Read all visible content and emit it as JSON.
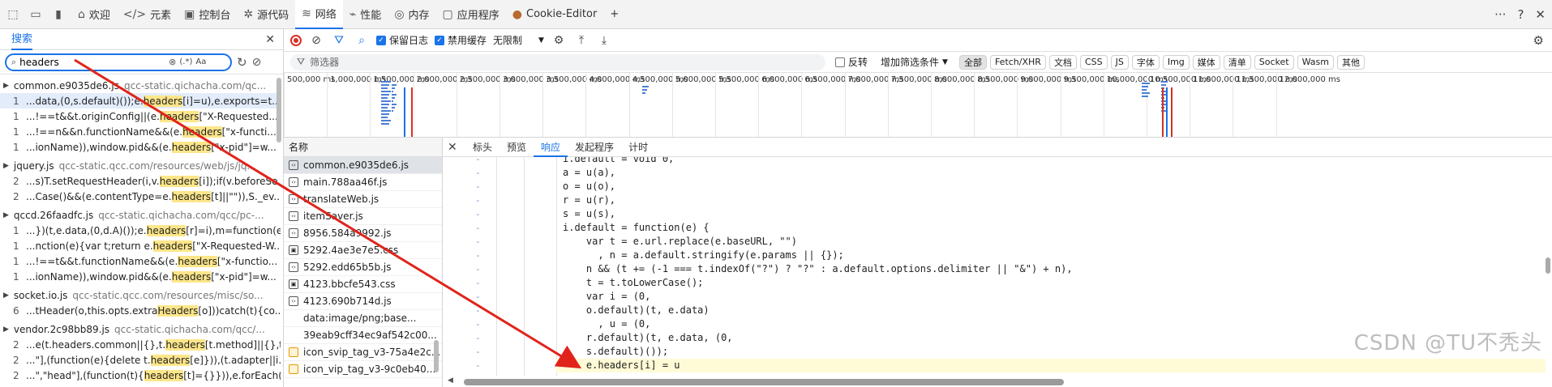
{
  "topbar": {
    "tabs": [
      {
        "label": "欢迎",
        "icon": "home-icon"
      },
      {
        "label": "元素",
        "icon": "code-icon"
      },
      {
        "label": "控制台",
        "icon": "console-icon"
      },
      {
        "label": "源代码",
        "icon": "bug-icon"
      },
      {
        "label": "网络",
        "icon": "wifi-icon"
      },
      {
        "label": "性能",
        "icon": "performance-icon"
      },
      {
        "label": "内存",
        "icon": "memory-icon"
      },
      {
        "label": "应用程序",
        "icon": "application-icon"
      },
      {
        "label": "Cookie-Editor",
        "icon": "cookie-icon"
      }
    ],
    "add_tab": "+",
    "help": "?",
    "more": "···",
    "close": "✕"
  },
  "search_panel": {
    "title": "搜索",
    "query": "headers",
    "regex_label": "(.*)",
    "case_label": "Aa",
    "groups": [
      {
        "file": "common.e9035de6.js",
        "url": "qcc-static.qichacha.com/qc...",
        "rows": [
          {
            "line": "1",
            "pre": "...data,(0,s.default)());e.",
            "match": "headers",
            "post": "[i]=u),e.exports=t..."
          },
          {
            "line": "1",
            "pre": "...!==t&&t.originConfig||(e.",
            "match": "headers",
            "post": "[\"X-Requested..."
          },
          {
            "line": "1",
            "pre": "...!==n&&n.functionName&&(e.",
            "match": "headers",
            "post": "[\"x-functi..."
          },
          {
            "line": "1",
            "pre": "...ionName)),window.pid&&(e.",
            "match": "headers",
            "post": "[\"x-pid\"]=w..."
          }
        ]
      },
      {
        "file": "jquery.js",
        "url": "qcc-static.qcc.com/resources/web/js/jq...",
        "rows": [
          {
            "line": "2",
            "pre": "...s)T.setRequestHeader(i,v.",
            "match": "headers",
            "post": "[i]);if(v.beforeSe..."
          },
          {
            "line": "2",
            "pre": "...Case()&&(e.contentType=e.",
            "match": "headers",
            "post": "[t]||\"\")),S._ev..."
          }
        ]
      },
      {
        "file": "qccd.26faadfc.js",
        "url": "qcc-static.qichacha.com/qcc/pc-...",
        "rows": [
          {
            "line": "1",
            "pre": "...})(t,e.data,(0,d.A)());e.",
            "match": "headers",
            "post": "[r]=i),m=function(e..."
          },
          {
            "line": "1",
            "pre": "...nction(e){var t;return e.",
            "match": "headers",
            "post": "[\"X-Requested-W..."
          },
          {
            "line": "1",
            "pre": "...!==t&&t.functionName&&(e.",
            "match": "headers",
            "post": "[\"x-functio..."
          },
          {
            "line": "1",
            "pre": "...ionName)),window.pid&&(e.",
            "match": "headers",
            "post": "[\"x-pid\"]=w..."
          }
        ]
      },
      {
        "file": "socket.io.js",
        "url": "qcc-static.qcc.com/resources/misc/so...",
        "rows": [
          {
            "line": "6",
            "pre": "...tHeader(o,this.opts.extra",
            "match": "Headers",
            "post": "[o]))catch(t){co..."
          }
        ]
      },
      {
        "file": "vendor.2c98bb89.js",
        "url": "qcc-static.qichacha.com/qcc/...",
        "rows": [
          {
            "line": "2",
            "pre": "...e(t.headers.common||{},t.",
            "match": "headers",
            "post": "[t.method]||{},t...."
          },
          {
            "line": "2",
            "pre": "...\"],(function(e){delete t.",
            "match": "headers",
            "post": "[e]})),(t.adapter||i..."
          },
          {
            "line": "2",
            "pre": "...\",\"head\"],(function(t){",
            "match": "headers",
            "post": "[t]={}})),e.forEach(..."
          }
        ]
      }
    ]
  },
  "network": {
    "preserve_log": "保留日志",
    "disable_cache": "禁用缓存",
    "throttle": "无限制",
    "filter_placeholder": "筛选器",
    "invert": "反转",
    "more_filters": "增加筛选条件",
    "chips": [
      "全部",
      "Fetch/XHR",
      "文档",
      "CSS",
      "JS",
      "字体",
      "Img",
      "媒体",
      "清单",
      "Socket",
      "Wasm",
      "其他"
    ],
    "ticks": [
      "500,000 ms",
      "1,000,000 ms",
      "1,500,000 ms",
      "2,000,000 ms",
      "2,500,000 ms",
      "3,000,000 ms",
      "3,500,000 ms",
      "4,000,000 ms",
      "4,500,000 ms",
      "5,000,000 ms",
      "5,500,000 ms",
      "6,000,000 ms",
      "6,500,000 ms",
      "7,000,000 ms",
      "7,500,000 ms",
      "8,000,000 ms",
      "8,500,000 ms",
      "9,000,000 ms",
      "9,500,000 ms",
      "10,000,000 ms",
      "10,500,000 ms",
      "11,000,000 ms",
      "11,500,000 ms",
      "12,000,000 ms"
    ],
    "list_header": "名称",
    "requests": [
      {
        "name": "common.e9035de6.js",
        "type": "js"
      },
      {
        "name": "main.788aa46f.js",
        "type": "js"
      },
      {
        "name": "translateWeb.js",
        "type": "js"
      },
      {
        "name": "itemSaver.js",
        "type": "js"
      },
      {
        "name": "8956.584a9992.js",
        "type": "js"
      },
      {
        "name": "5292.4ae3e7e5.css",
        "type": "css"
      },
      {
        "name": "5292.edd65b5b.js",
        "type": "js"
      },
      {
        "name": "4123.bbcfe543.css",
        "type": "css"
      },
      {
        "name": "4123.690b714d.js",
        "type": "js"
      },
      {
        "name": "data:image/png;base...",
        "type": "none"
      },
      {
        "name": "39eab9cff34ec9af542c00...",
        "type": "none"
      },
      {
        "name": "icon_svip_tag_v3-75a4e2c...",
        "type": "img"
      },
      {
        "name": "icon_vip_tag_v3-9c0eb40...",
        "type": "img"
      }
    ]
  },
  "details": {
    "tabs": [
      "标头",
      "预览",
      "响应",
      "发起程序",
      "计时"
    ],
    "code_lines": [
      "i.default = void 0,",
      "a = u(a),",
      "o = u(o),",
      "r = u(r),",
      "s = u(s),",
      "i.default = function(e) {",
      "    var t = e.url.replace(e.baseURL, \"\")",
      "      , n = a.default.stringify(e.params || {});",
      "    n && (t += (-1 === t.indexOf(\"?\") ? \"?\" : a.default.options.delimiter || \"&\") + n),",
      "    t = t.toLowerCase();",
      "    var i = (0,",
      "    o.default)(t, e.data)",
      "      , u = (0,",
      "    r.default)(t, e.data, (0,",
      "    s.default)());",
      "    e.headers[i] = u"
    ]
  },
  "watermark": "CSDN @TU不秃头"
}
